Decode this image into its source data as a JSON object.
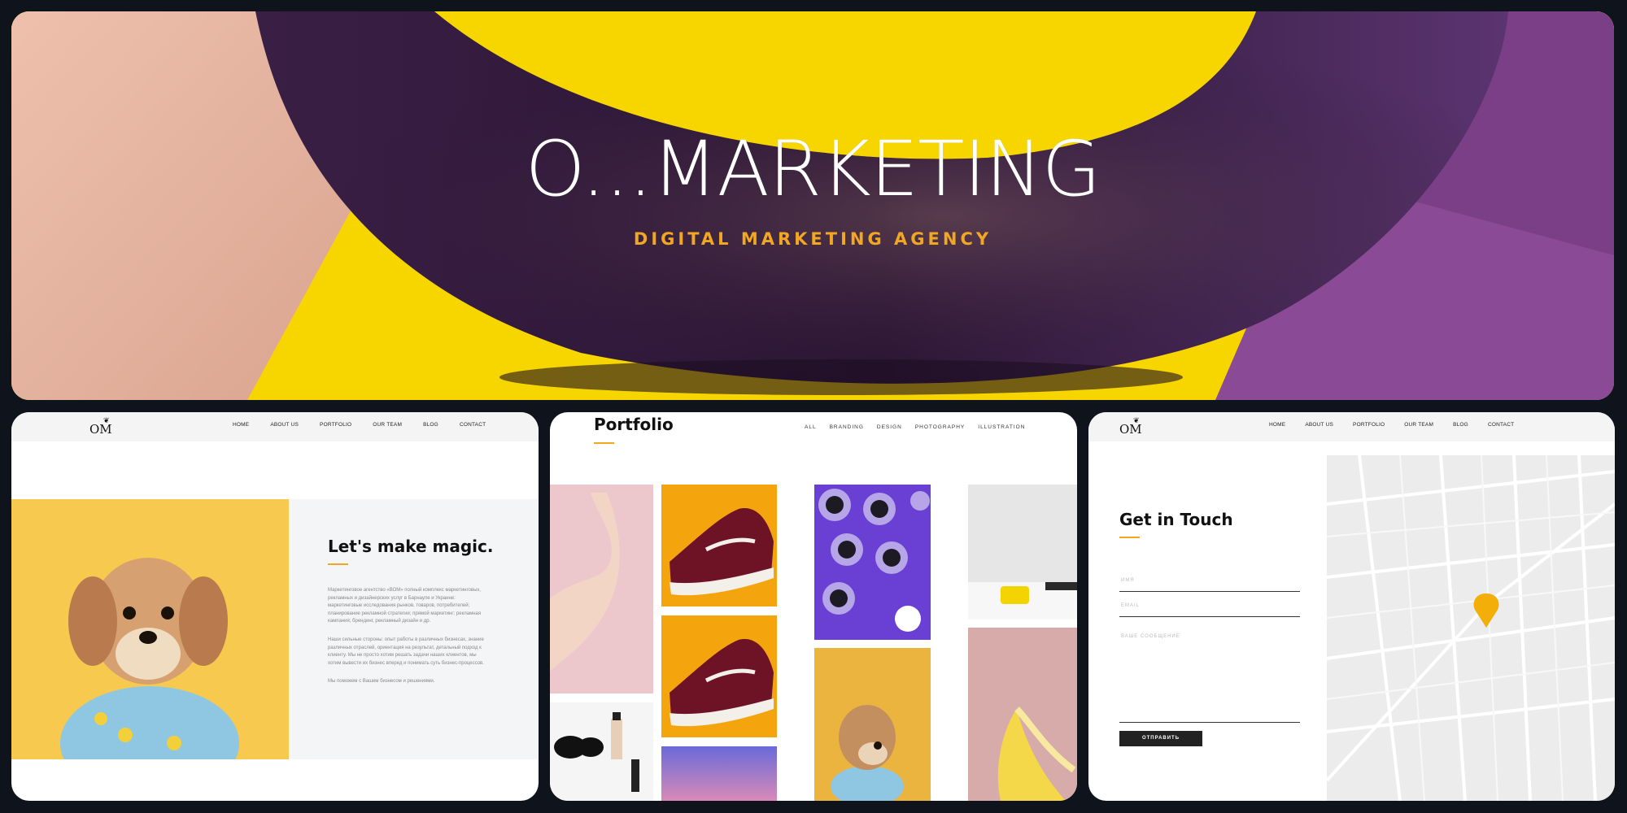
{
  "hero": {
    "title": "O...MARKETING",
    "subtitle": "DIGITAL MARKETING AGENCY"
  },
  "nav": {
    "logo": "OM",
    "links": [
      "HOME",
      "ABOUT US",
      "PORTFOLIO",
      "OUR TEAM",
      "BLOG",
      "CONTACT"
    ]
  },
  "about": {
    "title": "Let's make magic.",
    "paragraphs": [
      "Маркетинговое агентство «ВОМ» полный комплекс маркетинговых, рекламных и дизайнерских услуг в Барнауле и Украине: маркетинговые исследования рынков, товаров, потребителей; планирование рекламной стратегии; прямой маркетинг; рекламная кампания; брендинг, рекламный дизайн и др.",
      "Наши сильные стороны: опыт работы в различных бизнесах, знание различных отраслей, ориентация на результат, детальный подход к клиенту. Мы не просто хотим решать задачи наших клиентов, мы хотим вывести их бизнес вперед и понимать суть бизнес-процессов.",
      "Мы поможем с Вашим бизнесом и решениями."
    ]
  },
  "portfolio": {
    "title": "Portfolio",
    "filters": [
      "ALL",
      "BRANDING",
      "DESIGN",
      "PHOTOGRAPHY",
      "ILLUSTRATION"
    ]
  },
  "contact": {
    "title": "Get in Touch",
    "fields": [
      {
        "placeholder": "ИМЯ"
      },
      {
        "placeholder": "EMAIL"
      },
      {
        "placeholder": "ВАШЕ СООБЩЕНИЕ"
      }
    ],
    "submit_label": "ОТПРАВИТЬ"
  },
  "colors": {
    "accent": "#f1a722",
    "hero_purple": "#5a3468",
    "hero_yellow": "#f7d600",
    "hero_pink": "#e8b8a4"
  }
}
